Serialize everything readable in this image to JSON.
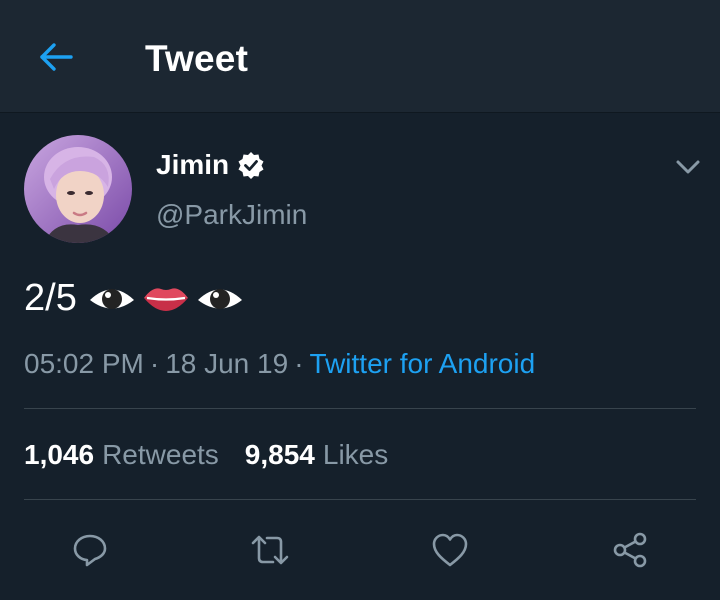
{
  "header": {
    "title": "Tweet",
    "back_icon": "arrow-left-icon",
    "accent": "#1da1f2"
  },
  "tweet": {
    "display_name": "Jimin",
    "verified": true,
    "handle": "@ParkJimin",
    "text": "2/5",
    "emojis": [
      "eye-emoji",
      "lips-emoji",
      "eye-emoji"
    ],
    "time": "05:02 PM",
    "date": "18 Jun 19",
    "source": "Twitter for Android",
    "retweets_count": "1,046",
    "retweets_label": "Retweets",
    "likes_count": "9,854",
    "likes_label": "Likes"
  },
  "actions": [
    "reply-icon",
    "retweet-icon",
    "like-icon",
    "share-icon"
  ],
  "colors": {
    "background": "#15202b",
    "header_bg": "#1c2732",
    "secondary_text": "#8899a6",
    "link": "#1da1f2",
    "divider": "#38444d"
  }
}
